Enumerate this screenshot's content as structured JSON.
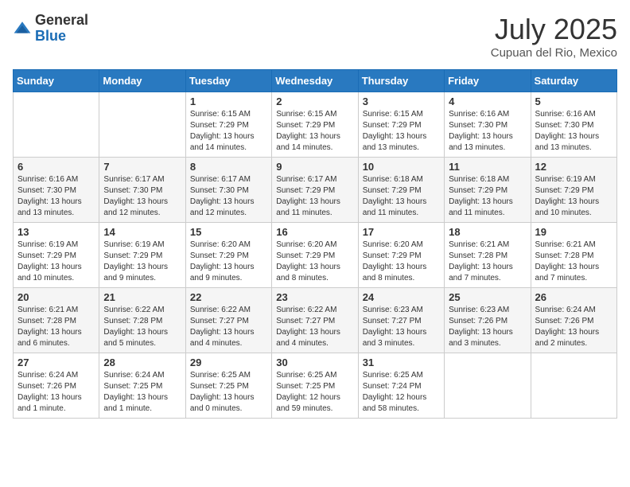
{
  "header": {
    "logo_general": "General",
    "logo_blue": "Blue",
    "title": "July 2025",
    "location": "Cupuan del Rio, Mexico"
  },
  "days_of_week": [
    "Sunday",
    "Monday",
    "Tuesday",
    "Wednesday",
    "Thursday",
    "Friday",
    "Saturday"
  ],
  "weeks": [
    [
      {
        "day": "",
        "info": ""
      },
      {
        "day": "",
        "info": ""
      },
      {
        "day": "1",
        "info": "Sunrise: 6:15 AM\nSunset: 7:29 PM\nDaylight: 13 hours and 14 minutes."
      },
      {
        "day": "2",
        "info": "Sunrise: 6:15 AM\nSunset: 7:29 PM\nDaylight: 13 hours and 14 minutes."
      },
      {
        "day": "3",
        "info": "Sunrise: 6:15 AM\nSunset: 7:29 PM\nDaylight: 13 hours and 13 minutes."
      },
      {
        "day": "4",
        "info": "Sunrise: 6:16 AM\nSunset: 7:30 PM\nDaylight: 13 hours and 13 minutes."
      },
      {
        "day": "5",
        "info": "Sunrise: 6:16 AM\nSunset: 7:30 PM\nDaylight: 13 hours and 13 minutes."
      }
    ],
    [
      {
        "day": "6",
        "info": "Sunrise: 6:16 AM\nSunset: 7:30 PM\nDaylight: 13 hours and 13 minutes."
      },
      {
        "day": "7",
        "info": "Sunrise: 6:17 AM\nSunset: 7:30 PM\nDaylight: 13 hours and 12 minutes."
      },
      {
        "day": "8",
        "info": "Sunrise: 6:17 AM\nSunset: 7:30 PM\nDaylight: 13 hours and 12 minutes."
      },
      {
        "day": "9",
        "info": "Sunrise: 6:17 AM\nSunset: 7:29 PM\nDaylight: 13 hours and 11 minutes."
      },
      {
        "day": "10",
        "info": "Sunrise: 6:18 AM\nSunset: 7:29 PM\nDaylight: 13 hours and 11 minutes."
      },
      {
        "day": "11",
        "info": "Sunrise: 6:18 AM\nSunset: 7:29 PM\nDaylight: 13 hours and 11 minutes."
      },
      {
        "day": "12",
        "info": "Sunrise: 6:19 AM\nSunset: 7:29 PM\nDaylight: 13 hours and 10 minutes."
      }
    ],
    [
      {
        "day": "13",
        "info": "Sunrise: 6:19 AM\nSunset: 7:29 PM\nDaylight: 13 hours and 10 minutes."
      },
      {
        "day": "14",
        "info": "Sunrise: 6:19 AM\nSunset: 7:29 PM\nDaylight: 13 hours and 9 minutes."
      },
      {
        "day": "15",
        "info": "Sunrise: 6:20 AM\nSunset: 7:29 PM\nDaylight: 13 hours and 9 minutes."
      },
      {
        "day": "16",
        "info": "Sunrise: 6:20 AM\nSunset: 7:29 PM\nDaylight: 13 hours and 8 minutes."
      },
      {
        "day": "17",
        "info": "Sunrise: 6:20 AM\nSunset: 7:29 PM\nDaylight: 13 hours and 8 minutes."
      },
      {
        "day": "18",
        "info": "Sunrise: 6:21 AM\nSunset: 7:28 PM\nDaylight: 13 hours and 7 minutes."
      },
      {
        "day": "19",
        "info": "Sunrise: 6:21 AM\nSunset: 7:28 PM\nDaylight: 13 hours and 7 minutes."
      }
    ],
    [
      {
        "day": "20",
        "info": "Sunrise: 6:21 AM\nSunset: 7:28 PM\nDaylight: 13 hours and 6 minutes."
      },
      {
        "day": "21",
        "info": "Sunrise: 6:22 AM\nSunset: 7:28 PM\nDaylight: 13 hours and 5 minutes."
      },
      {
        "day": "22",
        "info": "Sunrise: 6:22 AM\nSunset: 7:27 PM\nDaylight: 13 hours and 4 minutes."
      },
      {
        "day": "23",
        "info": "Sunrise: 6:22 AM\nSunset: 7:27 PM\nDaylight: 13 hours and 4 minutes."
      },
      {
        "day": "24",
        "info": "Sunrise: 6:23 AM\nSunset: 7:27 PM\nDaylight: 13 hours and 3 minutes."
      },
      {
        "day": "25",
        "info": "Sunrise: 6:23 AM\nSunset: 7:26 PM\nDaylight: 13 hours and 3 minutes."
      },
      {
        "day": "26",
        "info": "Sunrise: 6:24 AM\nSunset: 7:26 PM\nDaylight: 13 hours and 2 minutes."
      }
    ],
    [
      {
        "day": "27",
        "info": "Sunrise: 6:24 AM\nSunset: 7:26 PM\nDaylight: 13 hours and 1 minute."
      },
      {
        "day": "28",
        "info": "Sunrise: 6:24 AM\nSunset: 7:25 PM\nDaylight: 13 hours and 1 minute."
      },
      {
        "day": "29",
        "info": "Sunrise: 6:25 AM\nSunset: 7:25 PM\nDaylight: 13 hours and 0 minutes."
      },
      {
        "day": "30",
        "info": "Sunrise: 6:25 AM\nSunset: 7:25 PM\nDaylight: 12 hours and 59 minutes."
      },
      {
        "day": "31",
        "info": "Sunrise: 6:25 AM\nSunset: 7:24 PM\nDaylight: 12 hours and 58 minutes."
      },
      {
        "day": "",
        "info": ""
      },
      {
        "day": "",
        "info": ""
      }
    ]
  ]
}
